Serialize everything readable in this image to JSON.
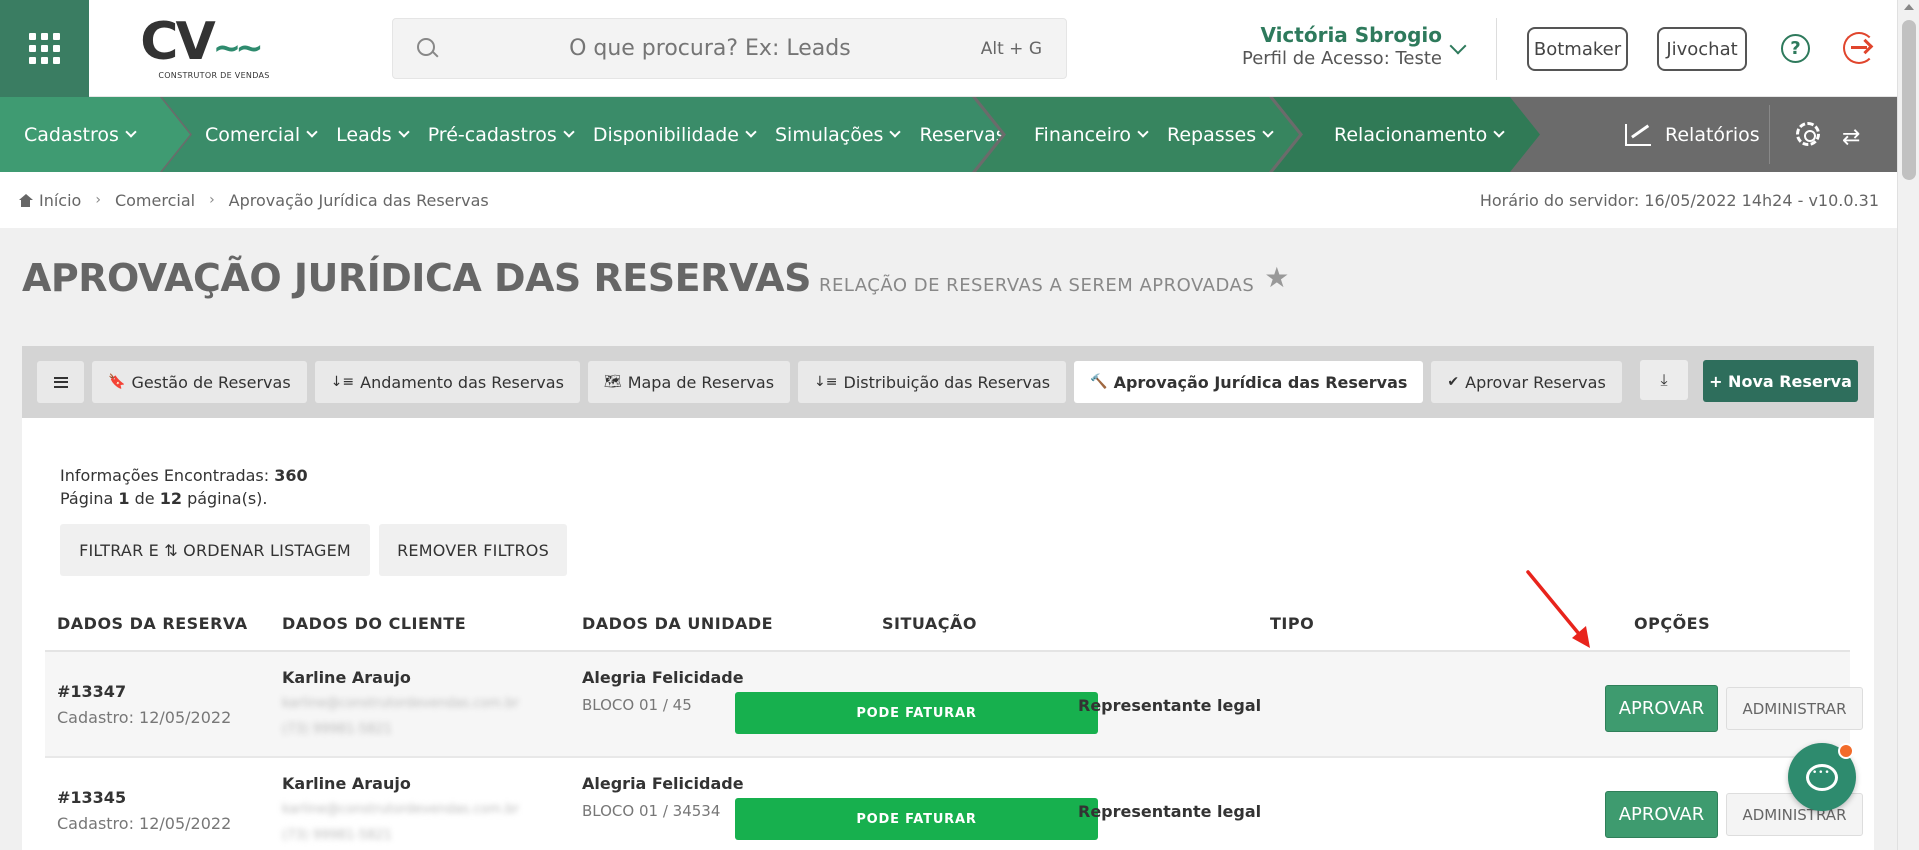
{
  "header": {
    "logo_text": "CV",
    "logo_wave": "~~",
    "logo_subtitle": "CONSTRUTOR DE VENDAS",
    "search_placeholder": "O que procura? Ex: Leads",
    "search_shortcut": "Alt + G",
    "user_name": "Victória Sbrogio",
    "user_profile": "Perfil de Acesso: Teste",
    "botmaker_label": "Botmaker",
    "jivochat_label": "Jivochat",
    "help_label": "?"
  },
  "nav": {
    "seg1": [
      {
        "label": "Cadastros"
      }
    ],
    "seg2": [
      {
        "label": "Comercial"
      },
      {
        "label": "Leads"
      },
      {
        "label": "Pré-cadastros"
      },
      {
        "label": "Disponibilidade"
      },
      {
        "label": "Simulações"
      },
      {
        "label": "Reservas"
      }
    ],
    "seg3": [
      {
        "label": "Financeiro"
      },
      {
        "label": "Repasses"
      }
    ],
    "seg4": [
      {
        "label": "Relacionamento"
      }
    ],
    "reports_label": "Relatórios",
    "swap_glyph": "⇄"
  },
  "breadcrumb": {
    "items": [
      "Início",
      "Comercial",
      "Aprovação Jurídica das Reservas"
    ],
    "server_time": "Horário do servidor: 16/05/2022 14h24 - v10.0.31"
  },
  "page": {
    "title": "APROVAÇÃO JURÍDICA DAS RESERVAS",
    "subtitle": "RELAÇÃO DE RESERVAS A SEREM APROVADAS"
  },
  "tabs": {
    "items": [
      {
        "label": "Gestão de Reservas",
        "icon": "🔖"
      },
      {
        "label": "Andamento das Reservas",
        "icon": "↓≡"
      },
      {
        "label": "Mapa de Reservas",
        "icon": "🗺"
      },
      {
        "label": "Distribuição das Reservas",
        "icon": "↓≡"
      },
      {
        "label": "Aprovação Jurídica das Reservas",
        "icon": "🔨"
      },
      {
        "label": "Aprovar Reservas",
        "icon": "✔"
      }
    ],
    "active_index": 4,
    "download_glyph": "⤓",
    "new_label": "+ Nova Reserva"
  },
  "results": {
    "found_label": "Informações Encontradas:",
    "found_count": "360",
    "page_prefix": "Página",
    "page_current": "1",
    "page_of": "de",
    "page_total": "12",
    "page_suffix": "página(s).",
    "filter_label": "FILTRAR E ⇅ ORDENAR LISTAGEM",
    "remove_filters_label": "REMOVER FILTROS"
  },
  "table": {
    "headers": [
      "DADOS DA RESERVA",
      "DADOS DO CLIENTE",
      "DADOS DA UNIDADE",
      "SITUAÇÃO",
      "TIPO",
      "OPÇÕES"
    ],
    "rows": [
      {
        "id": "#13347",
        "date": "Cadastro: 12/05/2022",
        "client": "Karline Araujo",
        "email": "karline@construtordevendas.com.br",
        "phone": "(73) 99981-5821",
        "unit": "Alegria Felicidade",
        "location": "BLOCO 01 / 45",
        "status": "PODE FATURAR",
        "tipo": "Representante legal",
        "approve_label": "APROVAR",
        "admin_label": "ADMINISTRAR"
      },
      {
        "id": "#13345",
        "date": "Cadastro: 12/05/2022",
        "client": "Karline Araujo",
        "email": "karline@construtordevendas.com.br",
        "phone": "(73) 99981-5821",
        "unit": "Alegria Felicidade",
        "location": "BLOCO 01 / 34534",
        "status": "PODE FATURAR",
        "tipo": "Representante legal",
        "approve_label": "APROVAR",
        "admin_label": "ADMINISTRAR"
      }
    ]
  },
  "colors": {
    "brand_green": "#3a7d62",
    "status_green": "#17b04e",
    "approve_green": "#3e9b6f",
    "annotation_red": "#e8241c"
  }
}
